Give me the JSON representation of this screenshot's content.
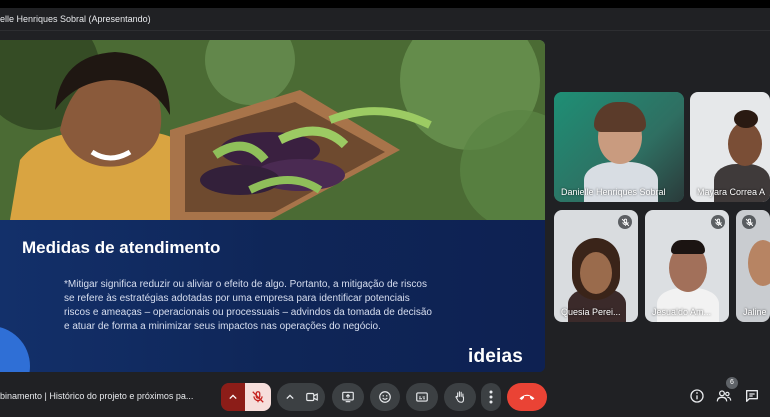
{
  "presenter_label": "elle Henriques Sobral (Apresentando)",
  "slide": {
    "title": "Medidas de atendimento",
    "body": "*Mitigar significa reduzir ou aliviar o efeito de algo. Portanto, a mitigação de riscos se refere às estratégias adotadas por uma empresa para identificar potenciais riscos e ameaças – operacionais ou processuais – advindos da tomada de decisão e atuar de forma a minimizar seus impactos nas operações do negócio.",
    "logo": "ideias"
  },
  "participants": [
    {
      "name": "Danielle Henriques Sobral",
      "muted": false
    },
    {
      "name": "Mayara Correa A",
      "muted": false
    },
    {
      "name": "Quesia Perei...",
      "muted": true
    },
    {
      "name": "Jesualdo Am...",
      "muted": true
    },
    {
      "name": "Jaline",
      "muted": true
    }
  ],
  "meeting_title": "binamento | Histórico do projeto e próximos pa...",
  "participant_count": "6",
  "colors": {
    "background": "#202124",
    "control": "#3c4043",
    "mic_muted_bg": "#f6dedb",
    "mic_muted_icon": "#c5221f",
    "end_call": "#ea4335",
    "slide_panel": "#10244f"
  }
}
